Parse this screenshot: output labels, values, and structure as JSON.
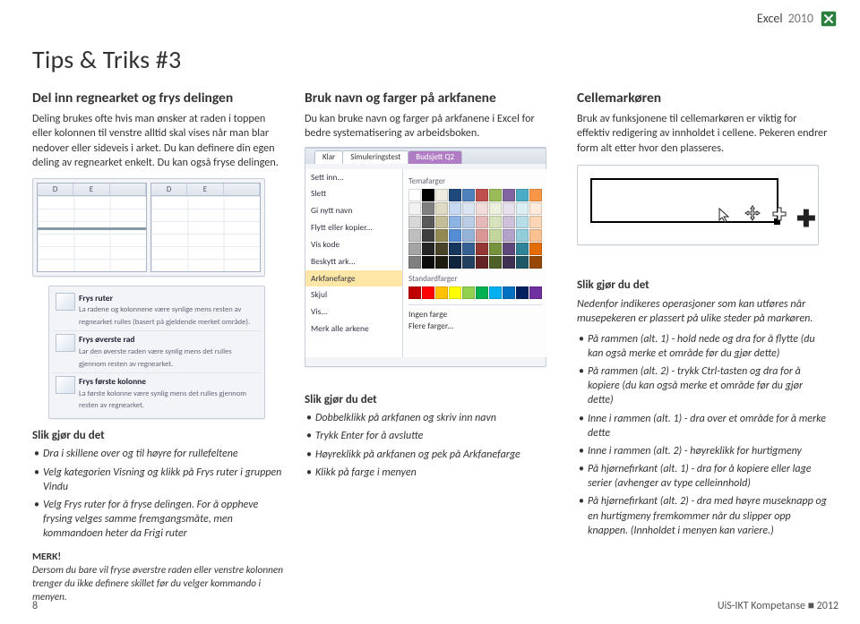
{
  "header": {
    "app": "Excel",
    "year": "2010"
  },
  "page_title": "Tips & Triks #3",
  "col1": {
    "heading": "Del inn regnearket og frys delingen",
    "intro": "Deling brukes ofte hvis man ønsker at raden i toppen eller kolonnen til venstre alltid skal vises når man blar nedover eller sideveis i arket. Du kan definere din egen deling av regnearket enkelt. Du kan også fryse delingen.",
    "panes": {
      "cols_left": [
        "D",
        "E"
      ],
      "cols_right": [
        "D",
        "E"
      ]
    },
    "freeze": {
      "items": [
        {
          "title": "Frys ruter",
          "desc": "La radene og kolonnene være synlige mens resten av regnearket rulles (basert på gjeldende merket område)."
        },
        {
          "title": "Frys øverste rad",
          "desc": "Lar den øverste raden være synlig mens det rulles gjennom resten av regnearket."
        },
        {
          "title": "Frys første kolonne",
          "desc": "La første kolonne være synlig mens det rulles gjennom resten av regnearket."
        }
      ]
    },
    "howto_heading": "Slik gjør du det",
    "howto": [
      "Dra i skillene over og til høyre for rullefeltene",
      "Velg kategorien Visning og klikk på Frys ruter i gruppen Vindu",
      "Velg Frys ruter for å fryse delingen. For å oppheve frysing velges samme fremgangsmåte, men kommandoen heter da Frigi ruter"
    ],
    "merk_label": "MERK!",
    "merk_text": "Dersom du bare vil fryse øverstre raden eller venstre kolonnen trenger du ikke definere skillet før du velger kommando i menyen."
  },
  "col2": {
    "heading": "Bruk navn og farger på arkfanene",
    "intro": "Du kan bruke navn og farger på arkfanene i Excel for bedre systematisering av arbeidsboken.",
    "tabbar_tabs": [
      "Klar",
      "Simuleringstest",
      "Budsjett Q2"
    ],
    "ctx_items": [
      "Sett inn...",
      "Slett",
      "Gi nytt navn",
      "Flytt eller kopier...",
      "Vis kode",
      "Beskytt ark...",
      "Arkfanefarge",
      "Skjul",
      "Vis...",
      "Merk alle arkene"
    ],
    "ctx_hi": "Arkfanefarge",
    "swatch_titles": [
      "Temafarger",
      "Standardfarger"
    ],
    "extra_items": [
      "Ingen farge",
      "Flere farger..."
    ],
    "howto_heading": "Slik gjør du det",
    "howto": [
      "Dobbelklikk på arkfanen og skriv inn navn",
      "Trykk Enter for å avslutte",
      "Høyreklikk på arkfanen og pek på Arkfanefarge",
      "Klikk på farge i menyen"
    ]
  },
  "col3": {
    "heading": "Cellemarkøren",
    "intro": "Bruk av funksjonene til cellemarkøren er viktig for effektiv redigering av innholdet i cellene. Pekeren endrer form alt etter hvor den plasseres.",
    "howto_heading": "Slik gjør du det",
    "howto_intro": "Nedenfor indikeres operasjoner som kan utføres når musepekeren er plassert på ulike steder på markøren.",
    "howto": [
      "På rammen (alt. 1) - hold nede og dra for å flytte (du kan også merke et område før du gjør dette)",
      "På rammen (alt. 2) - trykk Ctrl-tasten og dra for å kopiere (du kan også merke et område før du gjør dette)",
      "Inne i rammen (alt. 1) - dra over et område for å merke dette",
      "Inne i rammen (alt. 2) - høyreklikk for hurtigmeny",
      "På hjørnefirkant (alt. 1) - dra for å kopiere eller lage serier (avhenger av type celleinnhold)",
      "På hjørnefirkant (alt. 2) - dra med høyre museknapp og en hurtigmeny fremkommer når du slipper opp knappen. (Innholdet i menyen kan variere.)"
    ]
  },
  "footer": {
    "page": "8",
    "credit": "UiS-IKT Kompetanse",
    "year_sym": "■ 2012"
  },
  "swatch_colors": [
    "#ffffff",
    "#000000",
    "#eeece1",
    "#1f497d",
    "#4f81bd",
    "#c0504d",
    "#9bbb59",
    "#8064a2",
    "#4bacc6",
    "#f79646",
    "#f2f2f2",
    "#7f7f7f",
    "#ddd9c3",
    "#c6d9f0",
    "#dbe5f1",
    "#f2dcdb",
    "#ebf1dd",
    "#e5e0ec",
    "#dbeef3",
    "#fdeada",
    "#d8d8d8",
    "#595959",
    "#c4bd97",
    "#8db3e2",
    "#b8cce4",
    "#e5b9b7",
    "#d7e3bc",
    "#ccc1d9",
    "#b7dde8",
    "#fbd5b5",
    "#bfbfbf",
    "#3f3f3f",
    "#938953",
    "#548dd4",
    "#95b3d7",
    "#d99694",
    "#c3d69b",
    "#b2a2c7",
    "#92cddc",
    "#fac08f",
    "#a5a5a5",
    "#262626",
    "#494429",
    "#17365d",
    "#366092",
    "#953734",
    "#76923c",
    "#5f497a",
    "#31859b",
    "#e36c09",
    "#7f7f7f",
    "#0c0c0c",
    "#1d1b10",
    "#0f243e",
    "#244061",
    "#632423",
    "#4f6128",
    "#3f3151",
    "#205867",
    "#974806"
  ],
  "std_colors": [
    "#c00000",
    "#ff0000",
    "#ffc000",
    "#ffff00",
    "#92d050",
    "#00b050",
    "#00b0f0",
    "#0070c0",
    "#002060",
    "#7030a0"
  ]
}
